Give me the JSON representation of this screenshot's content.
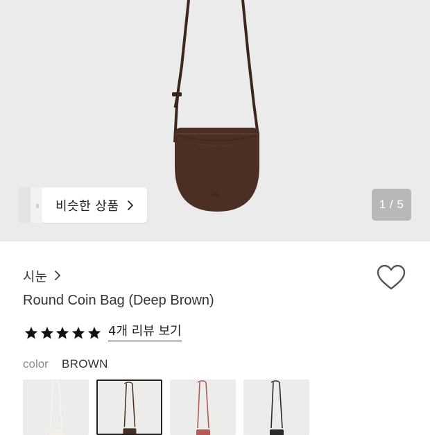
{
  "product_image": {
    "pager": "1 / 5",
    "similar_button": "비슷한 상품"
  },
  "product": {
    "brand": "시눈",
    "title": "Round Coin Bag (Deep Brown)",
    "rating_stars": 5,
    "review_link": "4개 리뷰 보기",
    "color_label": "color",
    "color_value": "BROWN"
  },
  "color_options": [
    {
      "name": "ivory",
      "color": "#f3efe6",
      "selected": false
    },
    {
      "name": "brown",
      "color": "#4a2e22",
      "selected": true
    },
    {
      "name": "red",
      "color": "#b55a55",
      "selected": false
    },
    {
      "name": "black",
      "color": "#2b2b2b",
      "selected": false
    }
  ],
  "colors": {
    "hero_bg": "#ebebeb",
    "bag": "#4b2f24",
    "pager_bg": "#b8b8b8",
    "text": "#333333",
    "muted": "#8a8a8a"
  }
}
